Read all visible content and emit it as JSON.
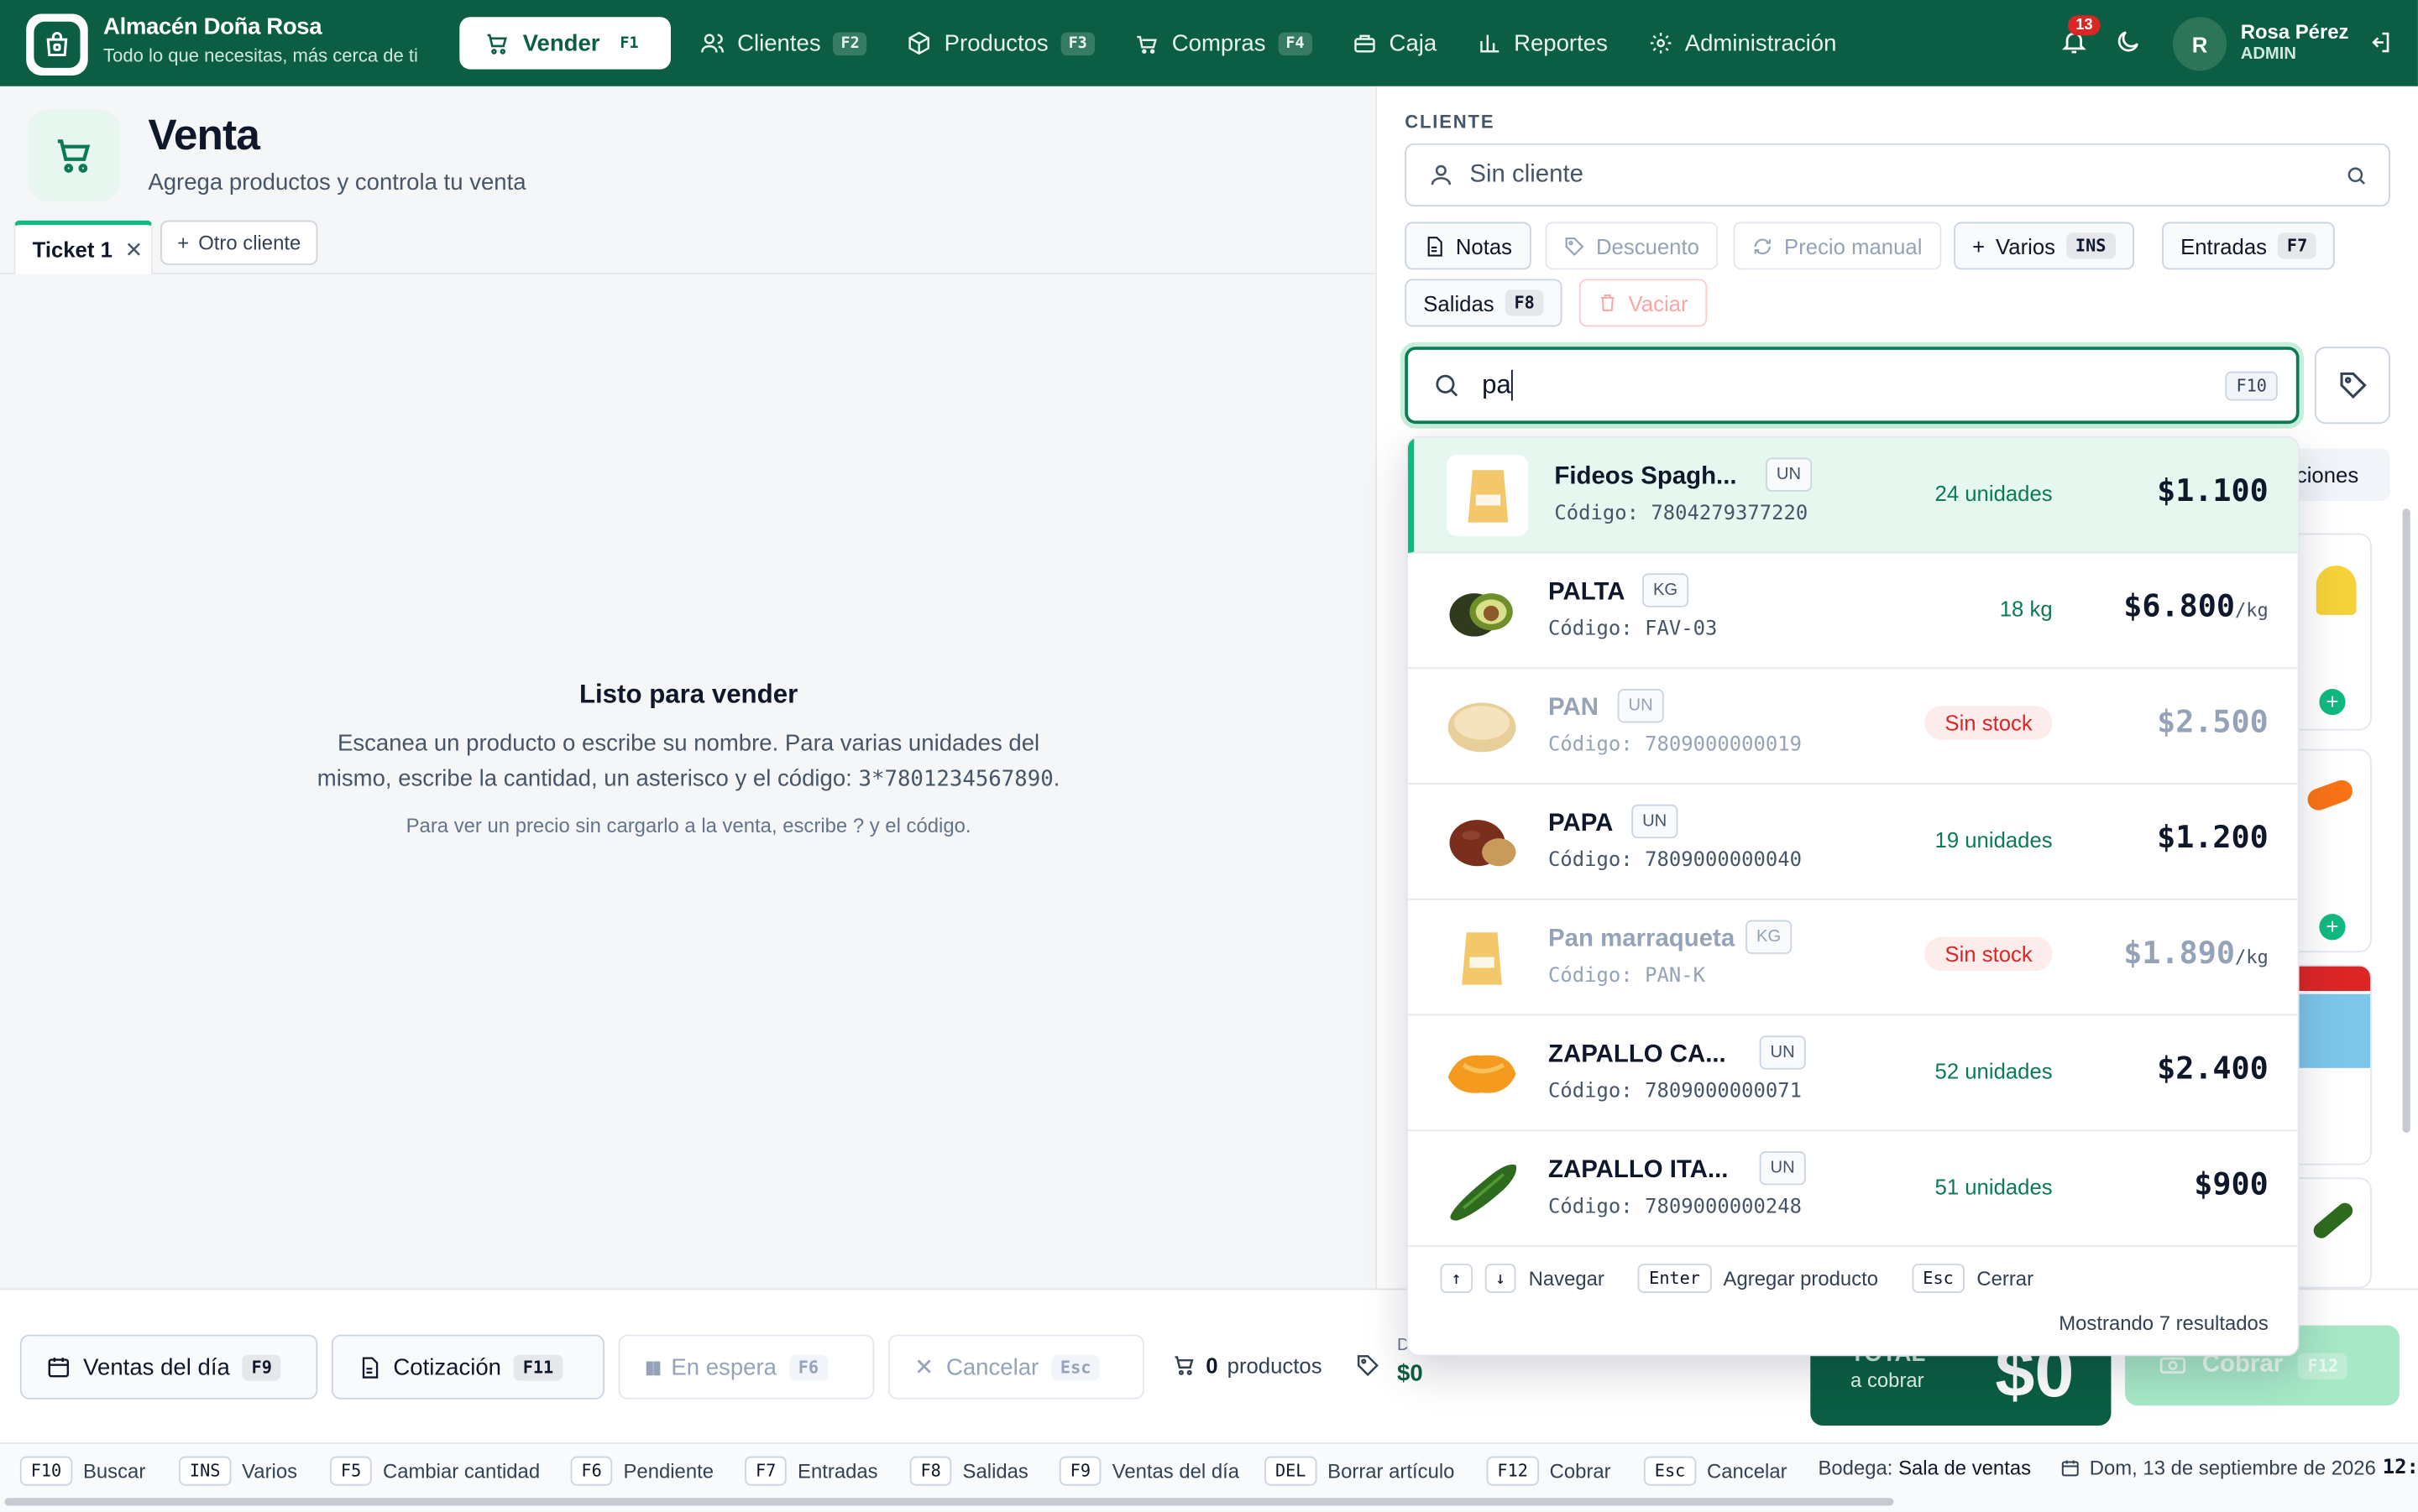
{
  "app": {
    "name": "Almacén Doña Rosa",
    "tagline": "Todo lo que necesitas, más cerca de ti"
  },
  "nav": [
    {
      "label": "Vender",
      "key": "F1",
      "icon": "cart-icon",
      "active": true
    },
    {
      "label": "Clientes",
      "key": "F2",
      "icon": "users-icon"
    },
    {
      "label": "Productos",
      "key": "F3",
      "icon": "box-icon"
    },
    {
      "label": "Compras",
      "key": "F4",
      "icon": "basket-icon"
    },
    {
      "label": "Caja",
      "key": "",
      "icon": "register-icon"
    },
    {
      "label": "Reportes",
      "key": "",
      "icon": "chart-icon"
    },
    {
      "label": "Administración",
      "key": "",
      "icon": "gear-icon"
    }
  ],
  "header": {
    "notifications": "13",
    "user_initial": "R",
    "user_name": "Rosa Pérez",
    "user_role": "ADMIN"
  },
  "page": {
    "title": "Venta",
    "subtitle": "Agrega productos y controla tu venta"
  },
  "tabs": {
    "current": "Ticket 1",
    "add_label": "Otro cliente"
  },
  "empty_state": {
    "title": "Listo para vender",
    "body": "Escanea un producto o escribe su nombre. Para varias unidades del mismo, escribe la cantidad, un asterisco y el código:",
    "example": "3*7801234567890",
    "note": "Para ver un precio sin cargarlo a la venta, escribe ? y el código."
  },
  "client": {
    "label": "CLIENTE",
    "placeholder": "Sin cliente"
  },
  "actions": [
    {
      "label": "Notas",
      "key": "",
      "state": "normal"
    },
    {
      "label": "Descuento",
      "key": "",
      "state": "disabled"
    },
    {
      "label": "Precio manual",
      "key": "",
      "state": "disabled"
    },
    {
      "label": "Varios",
      "key": "INS",
      "state": "normal"
    },
    {
      "label": "Entradas",
      "key": "F7",
      "state": "normal"
    },
    {
      "label": "Salidas",
      "key": "F8",
      "state": "normal"
    },
    {
      "label": "Vaciar",
      "key": "",
      "state": "danger"
    }
  ],
  "search": {
    "query": "pa",
    "key": "F10"
  },
  "behind_tab_text": "ciones",
  "results": [
    {
      "name": "Fideos Spagh...",
      "unit": "UN",
      "code_label": "Código:",
      "code": "7804279377220",
      "stock": "24 unidades",
      "price": "$1.100",
      "per": "",
      "status": "selected",
      "thumb": "bag"
    },
    {
      "name": "PALTA",
      "unit": "KG",
      "code_label": "Código:",
      "code": "FAV-03",
      "stock": "18 kg",
      "price": "$6.800",
      "per": "/kg",
      "status": "ok",
      "thumb": "avocado"
    },
    {
      "name": "PAN",
      "unit": "UN",
      "code_label": "Código:",
      "code": "7809000000019",
      "stock": "Sin stock",
      "price": "$2.500",
      "per": "",
      "status": "out",
      "thumb": "bread"
    },
    {
      "name": "PAPA",
      "unit": "UN",
      "code_label": "Código:",
      "code": "7809000000040",
      "stock": "19 unidades",
      "price": "$1.200",
      "per": "",
      "status": "ok",
      "thumb": "potato"
    },
    {
      "name": "Pan marraqueta",
      "unit": "KG",
      "code_label": "Código:",
      "code": "PAN-K",
      "stock": "Sin stock",
      "price": "$1.890",
      "per": "/kg",
      "status": "out",
      "thumb": "bag"
    },
    {
      "name": "ZAPALLO CA...",
      "unit": "UN",
      "code_label": "Código:",
      "code": "7809000000071",
      "stock": "52 unidades",
      "price": "$2.400",
      "per": "",
      "status": "ok",
      "thumb": "squash"
    },
    {
      "name": "ZAPALLO ITA...",
      "unit": "UN",
      "code_label": "Código:",
      "code": "7809000000248",
      "stock": "51 unidades",
      "price": "$900",
      "per": "",
      "status": "ok",
      "thumb": "zucchini"
    }
  ],
  "dropdown_footer": {
    "navigate": "Navegar",
    "enter_key": "Enter",
    "enter_label": "Agregar producto",
    "esc_key": "Esc",
    "esc_label": "Cerrar",
    "count": "Mostrando 7 resultados"
  },
  "bottom": {
    "buttons": [
      {
        "label": "Ventas del día",
        "key": "F9",
        "state": "normal"
      },
      {
        "label": "Cotización",
        "key": "F11",
        "state": "normal"
      },
      {
        "label": "En espera",
        "key": "F6",
        "state": "disabled"
      },
      {
        "label": "Cancelar",
        "key": "Esc",
        "state": "disabled"
      }
    ],
    "product_count": "0",
    "product_word": "productos",
    "discount_label": "D",
    "discount_value": "$0",
    "total_label": "TOTAL",
    "total_sub": "a cobrar",
    "total_value": "$0",
    "pay_label": "Cobrar",
    "pay_key": "F12"
  },
  "shortcuts": [
    {
      "key": "F10",
      "label": "Buscar"
    },
    {
      "key": "INS",
      "label": "Varios"
    },
    {
      "key": "F5",
      "label": "Cambiar cantidad"
    },
    {
      "key": "F6",
      "label": "Pendiente"
    },
    {
      "key": "F7",
      "label": "Entradas"
    },
    {
      "key": "F8",
      "label": "Salidas"
    },
    {
      "key": "F9",
      "label": "Ventas del día"
    },
    {
      "key": "DEL",
      "label": "Borrar artículo"
    },
    {
      "key": "F12",
      "label": "Cobrar"
    },
    {
      "key": "Esc",
      "label": "Cancelar"
    }
  ],
  "status": {
    "bodega_label": "Bodega:",
    "bodega": "Sala de ventas",
    "date": "Dom, 13 de septiembre de 2026",
    "time": "12:"
  },
  "colors": {
    "brand": "#0b5e43",
    "accent": "#10b981",
    "danger": "#dc2626"
  }
}
